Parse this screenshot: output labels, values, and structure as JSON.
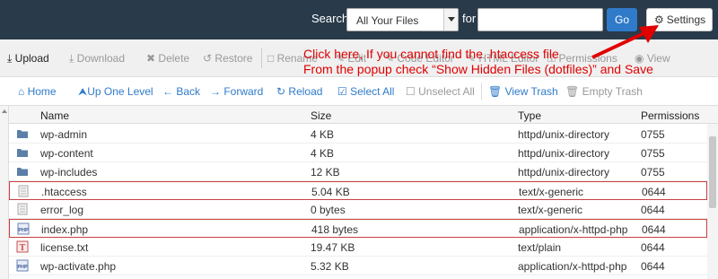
{
  "topbar": {
    "search_label": "Search",
    "search_scope": "All Your Files",
    "for_label": "for",
    "search_value": "",
    "go_label": "Go",
    "settings_label": "Settings"
  },
  "toolbar": {
    "upload": "Upload",
    "download": "Download",
    "delete": "Delete",
    "restore": "Restore",
    "rename": "Rename",
    "edit": "Edit",
    "code_editor": "Code Editor",
    "html_editor": "HTML Editor",
    "permissions": "Permissions",
    "view": "View"
  },
  "annotation": {
    "line1": "Click here, If you cannot find the .htaccess file",
    "line2": "From the popup check “Show Hidden Files (dotfiles)” and Save",
    "color": "#e00000"
  },
  "nav": {
    "home": "Home",
    "up_one_level": "Up One Level",
    "back": "Back",
    "forward": "Forward",
    "reload": "Reload",
    "select_all": "Select All",
    "unselect_all": "Unselect All",
    "view_trash": "View Trash",
    "empty_trash": "Empty Trash"
  },
  "table": {
    "headers": {
      "name": "Name",
      "size": "Size",
      "type": "Type",
      "permissions": "Permissions"
    },
    "rows": [
      {
        "icon": "folder-icon",
        "name": "wp-admin",
        "size": "4 KB",
        "type": "httpd/unix-directory",
        "perms": "0755"
      },
      {
        "icon": "folder-icon",
        "name": "wp-content",
        "size": "4 KB",
        "type": "httpd/unix-directory",
        "perms": "0755"
      },
      {
        "icon": "folder-icon",
        "name": "wp-includes",
        "size": "12 KB",
        "type": "httpd/unix-directory",
        "perms": "0755"
      },
      {
        "icon": "text-file-icon",
        "name": ".htaccess",
        "size": "5.04 KB",
        "type": "text/x-generic",
        "perms": "0644"
      },
      {
        "icon": "text-file-icon",
        "name": "error_log",
        "size": "0 bytes",
        "type": "text/x-generic",
        "perms": "0644"
      },
      {
        "icon": "php-file-icon",
        "name": "index.php",
        "size": "418 bytes",
        "type": "application/x-httpd-php",
        "perms": "0644"
      },
      {
        "icon": "txt-file-icon",
        "name": "license.txt",
        "size": "19.47 KB",
        "type": "text/plain",
        "perms": "0644"
      },
      {
        "icon": "php-file-icon",
        "name": "wp-activate.php",
        "size": "5.32 KB",
        "type": "application/x-httpd-php",
        "perms": "0644"
      }
    ]
  },
  "colors": {
    "topbar": "#293a4a",
    "accent": "#2f7bc9",
    "highlight_border": "#c94040"
  }
}
